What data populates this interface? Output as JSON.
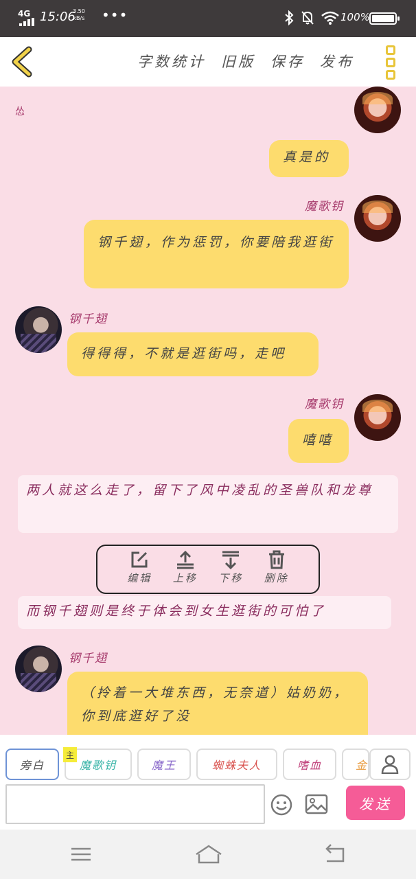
{
  "status_bar": {
    "network": "4G",
    "time": "15:06",
    "speed_value": "3.50",
    "speed_unit": "kB/s",
    "more": "•••",
    "battery_percent": "100%"
  },
  "header": {
    "actions": [
      "字数统计",
      "旧版",
      "保存",
      "发布"
    ]
  },
  "chat": {
    "top_label": "怂",
    "messages": [
      {
        "text": "真是的"
      },
      {
        "name": "魔歌钥",
        "text": "钢千翅，作为惩罚，你要陪我逛街"
      },
      {
        "name": "钢千翅",
        "text": "得得得，不就是逛街吗，走吧"
      },
      {
        "name": "魔歌钥",
        "text": "嘻嘻"
      },
      {
        "narration": "两人就这么走了，留下了风中凌乱的圣兽队和龙尊"
      },
      {
        "narration": "而钢千翅则是终于体会到女生逛街的可怕了"
      },
      {
        "name": "钢千翅",
        "text": "（拎着一大堆东西，无奈道）姑奶奶，你到底逛好了没"
      }
    ]
  },
  "edit_toolbar": {
    "edit": "编辑",
    "move_up": "上移",
    "move_down": "下移",
    "delete": "删除"
  },
  "roles": {
    "narrator": "旁白",
    "main_badge": "主",
    "items": [
      "魔歌钥",
      "魔王",
      "蜘蛛夫人",
      "嗜血",
      "金"
    ],
    "colors": {
      "魔歌钥": "#3ab5a8",
      "魔王": "#8a6acb",
      "蜘蛛夫人": "#d9534f",
      "嗜血": "#c0407a",
      "金": "#e89a3c"
    }
  },
  "input": {
    "value": "",
    "send_label": "发送"
  },
  "colors": {
    "accent": "#f55c97",
    "bubble": "#fddc6e",
    "background": "#fadde6",
    "name": "#a63a6c"
  }
}
